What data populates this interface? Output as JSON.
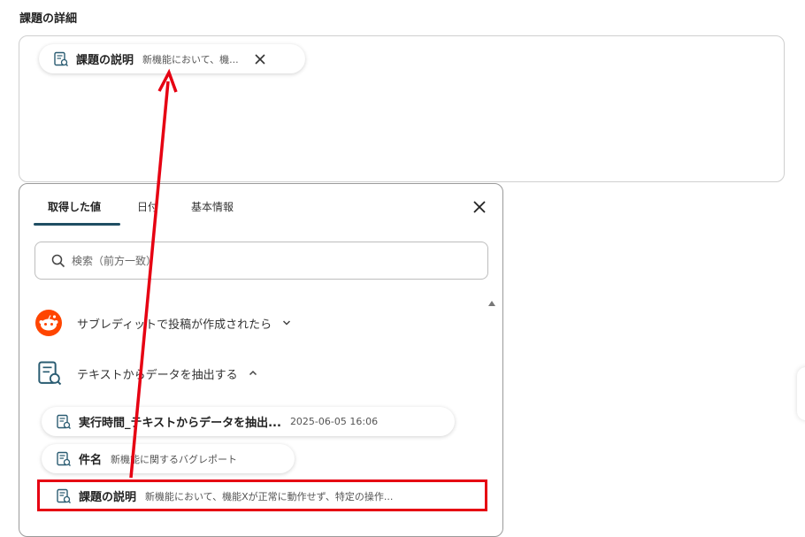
{
  "section_title": "課題の詳細",
  "field_chip": {
    "label": "課題の説明",
    "value": "新機能において、機..."
  },
  "panel": {
    "tabs": [
      {
        "label": "取得した値",
        "active": true
      },
      {
        "label": "日付",
        "active": false
      },
      {
        "label": "基本情報",
        "active": false
      }
    ],
    "search_placeholder": "検索（前方一致）",
    "groups": [
      {
        "label": "サブレディットで投稿が作成されたら",
        "expanded": false,
        "icon": "reddit-icon"
      },
      {
        "label": "テキストからデータを抽出する",
        "expanded": true,
        "icon": "document-icon"
      }
    ],
    "items": [
      {
        "label": "実行時間_テキストからデータを抽出...",
        "value": "2025-06-05 16:06"
      },
      {
        "label": "件名",
        "value": "新機能に関するバグレポート"
      },
      {
        "label": "課題の説明",
        "value": "新機能において、機能Xが正常に動作せず、特定の操作..."
      }
    ]
  },
  "colors": {
    "accent_tab": "#1f4e63",
    "highlight": "#e60012",
    "reddit": "#ff4500"
  }
}
